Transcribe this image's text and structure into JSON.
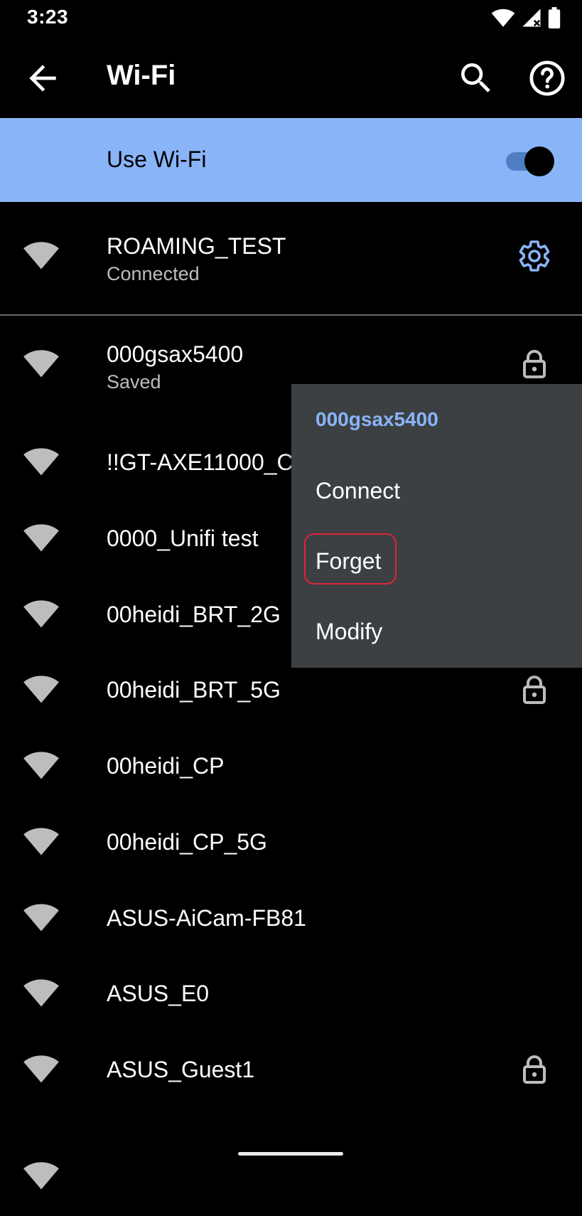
{
  "status_bar": {
    "time": "3:23",
    "icons": [
      "wifi-icon",
      "signal-off-icon",
      "battery-icon"
    ]
  },
  "app_bar": {
    "title": "Wi-Fi",
    "back_icon": "arrow-back-icon",
    "search_icon": "search-icon",
    "help_icon": "help-icon"
  },
  "use_wifi": {
    "label": "Use Wi-Fi",
    "enabled": true
  },
  "connected_network": {
    "name": "ROAMING_TEST",
    "status": "Connected",
    "trailing_icon": "gear-icon"
  },
  "networks": [
    {
      "name": "000gsax5400",
      "status": "Saved",
      "locked": true
    },
    {
      "name": "!!GT-AXE11000_C",
      "status": "",
      "locked": false
    },
    {
      "name": "0000_Unifi test",
      "status": "",
      "locked": false
    },
    {
      "name": "00heidi_BRT_2G",
      "status": "",
      "locked": false
    },
    {
      "name": "00heidi_BRT_5G",
      "status": "",
      "locked": true
    },
    {
      "name": "00heidi_CP",
      "status": "",
      "locked": false
    },
    {
      "name": "00heidi_CP_5G",
      "status": "",
      "locked": false
    },
    {
      "name": "ASUS-AiCam-FB81",
      "status": "",
      "locked": false
    },
    {
      "name": "ASUS_E0",
      "status": "",
      "locked": false
    },
    {
      "name": "ASUS_Guest1",
      "status": "",
      "locked": true
    }
  ],
  "context_menu": {
    "title": "000gsax5400",
    "items": [
      "Connect",
      "Forget",
      "Modify"
    ],
    "highlighted": "Forget"
  },
  "colors": {
    "accent": "#8ab4f8",
    "background": "#000000",
    "menu_bg": "#3c4043",
    "highlight_border": "#e0243c",
    "secondary_text": "#bdbdbd"
  }
}
